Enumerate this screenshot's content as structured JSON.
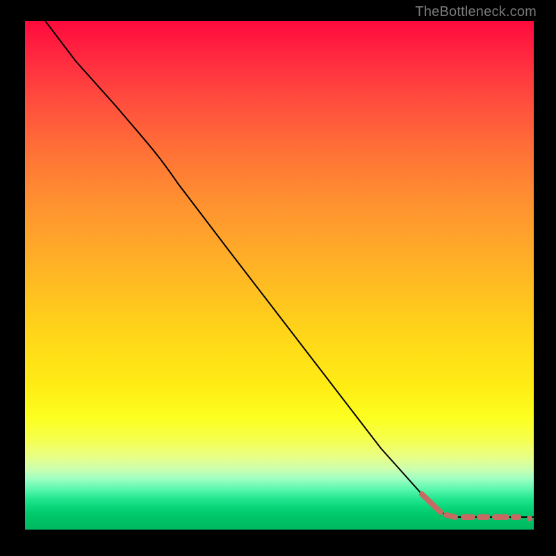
{
  "watermark": "TheBottleneck.com",
  "colors": {
    "dash": "#c66b63",
    "line": "#000000",
    "frame": "#000000"
  },
  "chart_data": {
    "type": "line",
    "title": "",
    "xlabel": "",
    "ylabel": "",
    "xlim": [
      0,
      100
    ],
    "ylim": [
      0,
      100
    ],
    "grid": false,
    "series": [
      {
        "name": "curve",
        "x": [
          4,
          10,
          18,
          24,
          30,
          40,
          50,
          60,
          70,
          78,
          82,
          84,
          86,
          88,
          90,
          92,
          94,
          96,
          98,
          100
        ],
        "y": [
          100,
          92,
          83,
          76,
          68,
          55,
          42,
          29,
          16,
          7,
          4,
          3,
          2.6,
          2.4,
          2.3,
          2.2,
          2.2,
          2.2,
          2.2,
          2.3
        ]
      }
    ],
    "dashed_region_x_start": 78,
    "annotations": []
  }
}
